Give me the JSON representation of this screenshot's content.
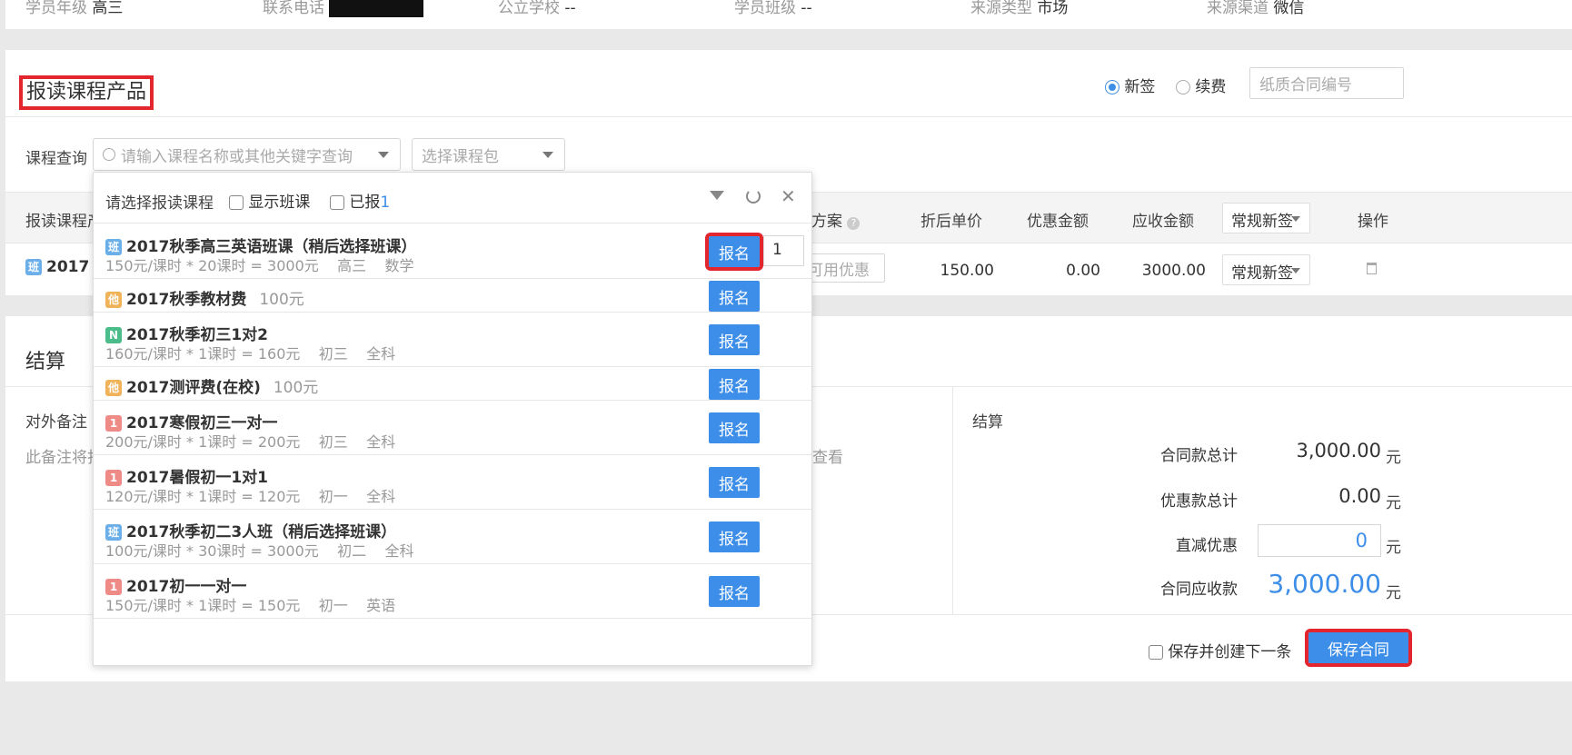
{
  "info": {
    "grade_label": "学员年级",
    "grade": "高三",
    "phone_label": "联系电话",
    "school_label": "公立学校",
    "school": "--",
    "class_label": "学员班级",
    "class": "--",
    "source_type_label": "来源类型",
    "source_type": "市场",
    "source_channel_label": "来源渠道",
    "source_channel": "微信"
  },
  "section": {
    "title": "报读课程产品",
    "radio_new": "新签",
    "radio_renew": "续费",
    "contract_placeholder": "纸质合同编号",
    "query_label": "课程查询",
    "search_placeholder": "请输入课程名称或其他关键字查询",
    "package_placeholder": "选择课程包"
  },
  "table": {
    "col_product": "报读课程产",
    "col_plan": "方案",
    "col_unit_price": "折后单价",
    "col_discount": "优惠金额",
    "col_receivable": "应收金额",
    "col_type": "常规新签",
    "col_ops": "操作",
    "row": {
      "badge": "班",
      "name": "2017",
      "coupon_placeholder": "可用优惠",
      "unit_price": "150.00",
      "discount": "0.00",
      "receivable": "3000.00",
      "type": "常规新签"
    }
  },
  "dropdown": {
    "title": "请选择报读课程",
    "show_class_label": "显示班课",
    "enrolled_label": "已报",
    "enrolled_count": "1",
    "enroll_button": "报名",
    "quantity": "1",
    "items": [
      {
        "badge": "班",
        "badge_color": "#6aaeea",
        "title": "2017秋季高三英语班课（稍后选择班课）",
        "sub": "150元/课时 * 20课时 = 3000元    高三    数学"
      },
      {
        "badge": "他",
        "badge_color": "#f0b35a",
        "title": "2017秋季教材费",
        "inline": "100元"
      },
      {
        "badge": "N",
        "badge_color": "#4cbc8a",
        "title": "2017秋季初三1对2",
        "sub": "160元/课时 * 1课时 = 160元    初三    全科"
      },
      {
        "badge": "他",
        "badge_color": "#f0b35a",
        "title": "2017测评费(在校)",
        "inline": "100元"
      },
      {
        "badge": "1",
        "badge_color": "#ef8b86",
        "title": "2017寒假初三一对一",
        "sub": "200元/课时 * 1课时 = 200元    初三    全科"
      },
      {
        "badge": "1",
        "badge_color": "#ef8b86",
        "title": "2017暑假初一1对1",
        "sub": "120元/课时 * 1课时 = 120元    初一    全科"
      },
      {
        "badge": "班",
        "badge_color": "#6aaeea",
        "title": "2017秋季初二3人班（稍后选择班课）",
        "sub": "100元/课时 * 30课时 = 3000元    初二    全科"
      },
      {
        "badge": "1",
        "badge_color": "#ef8b86",
        "title": "2017初一一对一",
        "sub": "150元/课时 * 1课时 = 150元    初一    英语"
      }
    ]
  },
  "settlement": {
    "title": "结算",
    "remark_label": "对外备注",
    "remark_text": "此备注将打",
    "remark_tail": "查看",
    "right_title": "结算",
    "total_label": "合同款总计",
    "total": "3,000.00",
    "discount_total_label": "优惠款总计",
    "discount_total": "0.00",
    "direct_label": "直减优惠",
    "direct_value": "0",
    "receivable_label": "合同应收款",
    "receivable": "3,000.00",
    "unit": "元",
    "save_next_label": "保存并创建下一条",
    "save_button": "保存合同"
  },
  "colors": {
    "accent": "#3d8ee8",
    "highlight": "#e3262e"
  }
}
